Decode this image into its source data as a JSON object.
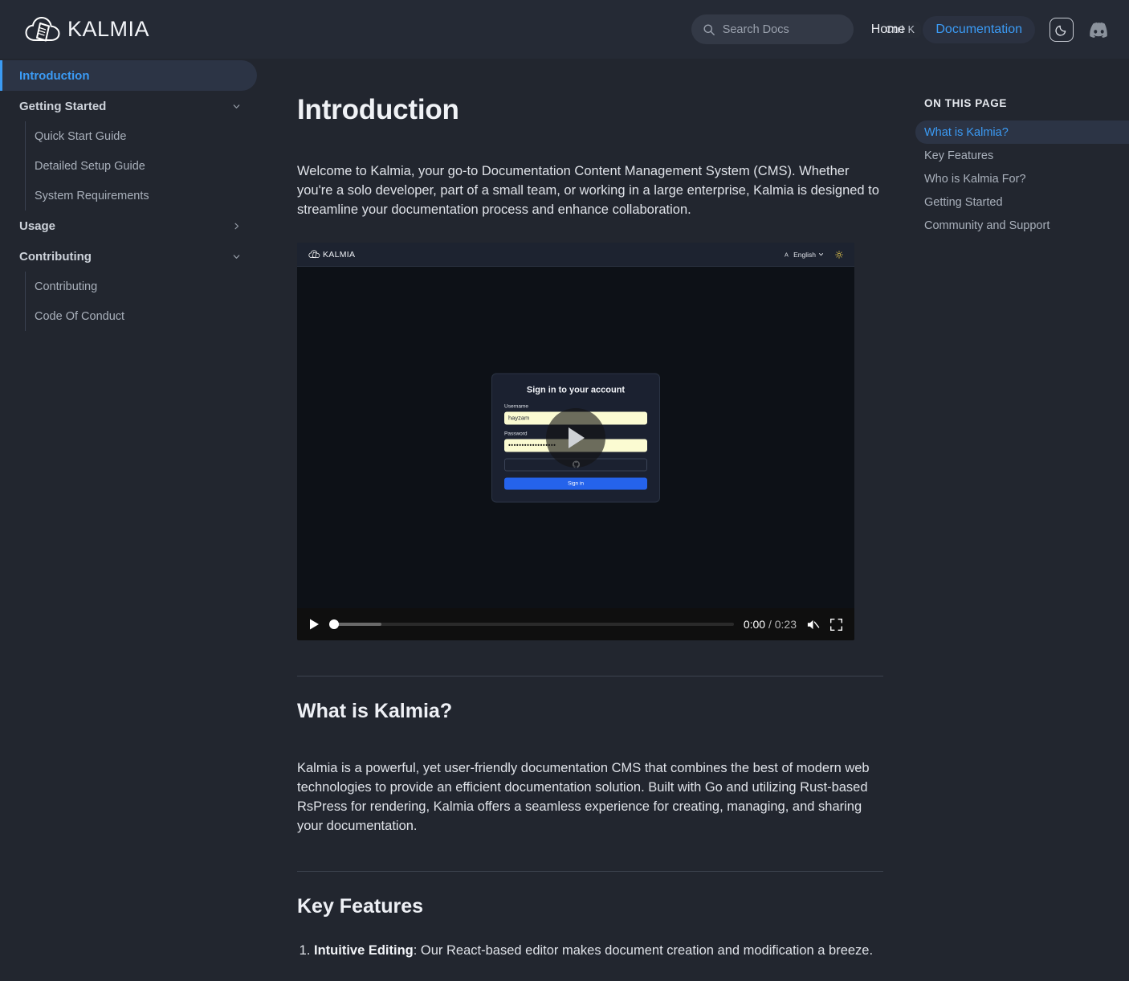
{
  "header": {
    "logo_text": "KALMIA",
    "search": {
      "placeholder": "Search Docs",
      "value": "",
      "shortcut": "Ctrl K"
    },
    "nav": [
      {
        "label": "Home",
        "active": false
      },
      {
        "label": "Documentation",
        "active": true
      }
    ],
    "theme_toggle_icon": "moon-icon",
    "discord_icon": "discord-icon",
    "accent_color": "#3b9bf5"
  },
  "sidebar": {
    "items": [
      {
        "label": "Introduction",
        "type": "link",
        "active": true
      },
      {
        "label": "Getting Started",
        "type": "group",
        "expanded": true,
        "chevron": "chevron-down-icon"
      },
      {
        "label": "Quick Start Guide",
        "type": "child"
      },
      {
        "label": "Detailed Setup Guide",
        "type": "child"
      },
      {
        "label": "System Requirements",
        "type": "child"
      },
      {
        "label": "Usage",
        "type": "group",
        "expanded": false,
        "chevron": "chevron-right-icon"
      },
      {
        "label": "Contributing",
        "type": "group",
        "expanded": true,
        "chevron": "chevron-down-icon"
      },
      {
        "label": "Contributing",
        "type": "child"
      },
      {
        "label": "Code Of Conduct",
        "type": "child"
      }
    ]
  },
  "main": {
    "title": "Introduction",
    "intro_paragraph": "Welcome to Kalmia, your go-to Documentation Content Management System (CMS). Whether you're a solo developer, part of a small team, or working in a large enterprise, Kalmia is designed to streamline your documentation process and enhance collaboration.",
    "video": {
      "mini_header": {
        "logo_text": "KALMIA",
        "language": "English",
        "language_icon": "translate-icon",
        "chevron": "chevron-down-icon",
        "theme_icon": "sun-icon"
      },
      "login_card": {
        "title": "Sign in to your account",
        "username_label": "Username",
        "username_value": "hayzam",
        "password_label": "Password",
        "password_value": "••••••••••••••••••",
        "oauth_icon": "github-icon",
        "submit_label": "Sign in"
      },
      "overlay_icon": "play-icon",
      "controls": {
        "play_icon": "play-icon",
        "current_time": "0:00",
        "separator": "/",
        "duration": "0:23",
        "mute_icon": "muted-speaker-icon",
        "fullscreen_icon": "fullscreen-icon",
        "progress_percent": 0
      }
    },
    "section_what": {
      "heading": "What is Kalmia?",
      "paragraph": "Kalmia is a powerful, yet user-friendly documentation CMS that combines the best of modern web technologies to provide an efficient documentation solution. Built with Go and utilizing Rust-based RsPress for rendering, Kalmia offers a seamless experience for creating, managing, and sharing your documentation."
    },
    "section_features": {
      "heading": "Key Features",
      "items": [
        {
          "term": "Intuitive Editing",
          "desc": ": Our React-based editor makes document creation and modification a breeze."
        }
      ]
    }
  },
  "toc": {
    "title": "ON THIS PAGE",
    "items": [
      {
        "label": "What is Kalmia?",
        "active": true
      },
      {
        "label": "Key Features",
        "active": false
      },
      {
        "label": "Who is Kalmia For?",
        "active": false
      },
      {
        "label": "Getting Started",
        "active": false
      },
      {
        "label": "Community and Support",
        "active": false
      }
    ]
  }
}
